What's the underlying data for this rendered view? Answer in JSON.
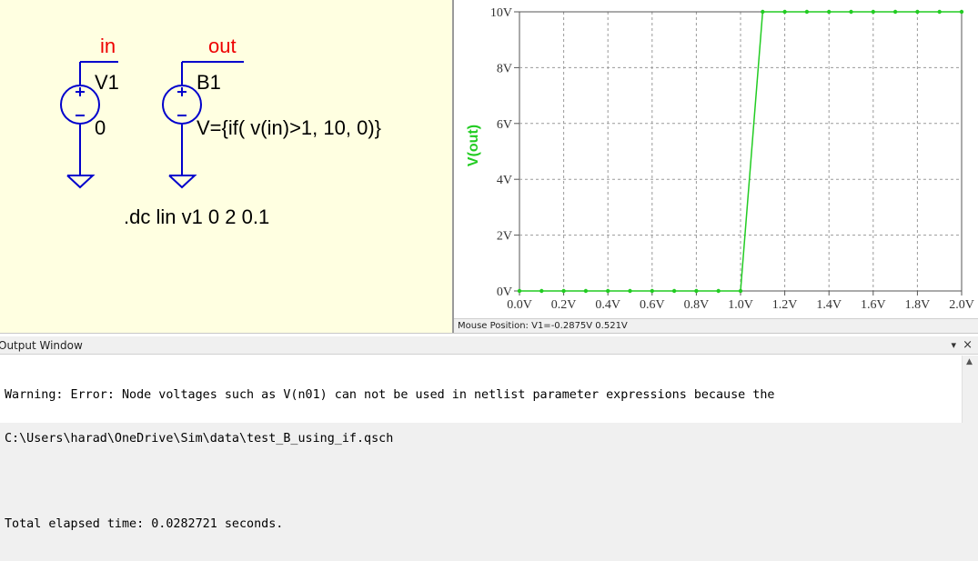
{
  "schematic": {
    "net_labels": [
      "in",
      "out"
    ],
    "components": [
      {
        "name": "V1",
        "value": "0"
      },
      {
        "name": "B1",
        "value": "V={if( v(in)>1, 10, 0)}"
      }
    ],
    "directive": ".dc lin v1 0 2 0.1",
    "colors": {
      "background": "#ffffe1",
      "wire": "#0000cc",
      "net_label": "#ee0000",
      "text": "#000000"
    },
    "icons": [
      "voltage-source-icon",
      "ground-icon"
    ]
  },
  "waveform": {
    "status": "Mouse Position: V1=-0.2875V  0.521V",
    "trace_color": "#22cc22",
    "chart_data": {
      "type": "line",
      "ylabel": "V(out)",
      "xlim": [
        0,
        2
      ],
      "ylim": [
        0,
        10
      ],
      "x_ticks": [
        "0.0V",
        "0.2V",
        "0.4V",
        "0.6V",
        "0.8V",
        "1.0V",
        "1.2V",
        "1.4V",
        "1.6V",
        "1.8V",
        "2.0V"
      ],
      "y_ticks": [
        "0V",
        "2V",
        "4V",
        "6V",
        "8V",
        "10V"
      ],
      "grid": true,
      "series": [
        {
          "x": [
            0.0,
            0.1,
            0.2,
            0.3,
            0.4,
            0.5,
            0.6,
            0.7,
            0.8,
            0.9,
            1.0,
            1.1,
            1.2,
            1.3,
            1.4,
            1.5,
            1.6,
            1.7,
            1.8,
            1.9,
            2.0
          ],
          "y": [
            0,
            0,
            0,
            0,
            0,
            0,
            0,
            0,
            0,
            0,
            0,
            10,
            10,
            10,
            10,
            10,
            10,
            10,
            10,
            10,
            10
          ]
        }
      ]
    }
  },
  "output": {
    "title": "Output Window",
    "controls": {
      "dropdown": "▾",
      "close": "×"
    },
    "lines": [
      "Warning: Error: Node voltages such as V(n01) can not be used in netlist parameter expressions because the",
      "C:\\Users\\harad\\OneDrive\\Sim\\data\\test_B_using_if.qsch",
      "",
      "Total elapsed time: 0.0282721 seconds."
    ]
  }
}
